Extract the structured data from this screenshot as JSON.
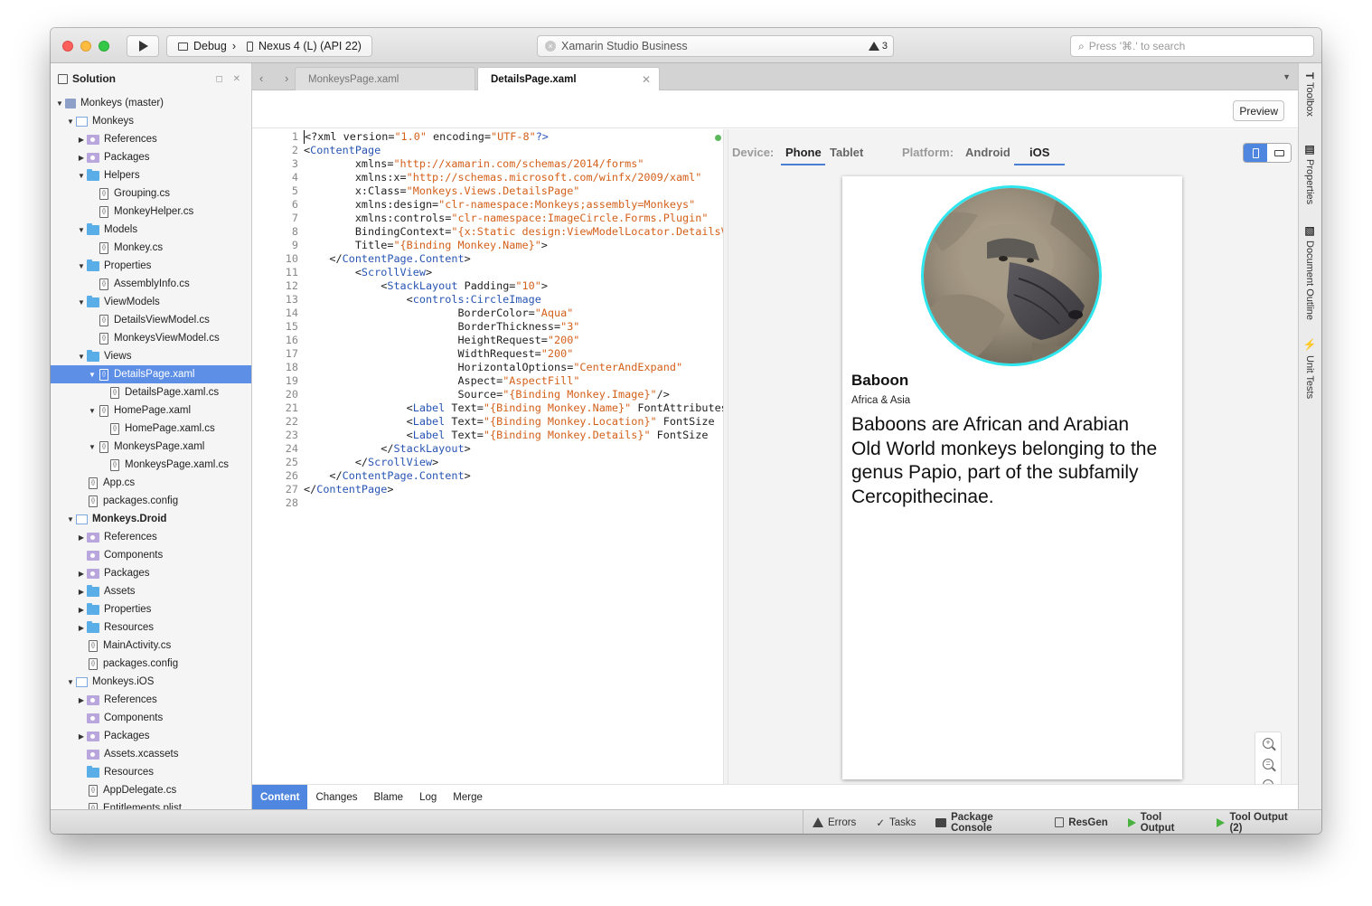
{
  "titlebar": {
    "config": "Debug",
    "config_sep": "›",
    "device": "Nexus 4 (L) (API 22)",
    "status": "Xamarin Studio Business",
    "warnings": "3",
    "search_placeholder": "Press '⌘.' to search"
  },
  "solution": {
    "title": "Solution",
    "controls": "◻ ✕",
    "rows": [
      {
        "label": "Monkeys (master)",
        "type": "solution",
        "arrow": "▼",
        "indent": 0
      },
      {
        "label": "Monkeys",
        "type": "project",
        "arrow": "▼",
        "indent": 1
      },
      {
        "label": "References",
        "type": "pfolder",
        "arrow": "▶",
        "indent": 2
      },
      {
        "label": "Packages",
        "type": "pfolder",
        "arrow": "▶",
        "indent": 2
      },
      {
        "label": "Helpers",
        "type": "folder",
        "arrow": "▼",
        "indent": 2
      },
      {
        "label": "Grouping.cs",
        "type": "file",
        "arrow": "",
        "indent": 3
      },
      {
        "label": "MonkeyHelper.cs",
        "type": "file",
        "arrow": "",
        "indent": 3
      },
      {
        "label": "Models",
        "type": "folder",
        "arrow": "▼",
        "indent": 2
      },
      {
        "label": "Monkey.cs",
        "type": "file",
        "arrow": "",
        "indent": 3
      },
      {
        "label": "Properties",
        "type": "folder",
        "arrow": "▼",
        "indent": 2
      },
      {
        "label": "AssemblyInfo.cs",
        "type": "file",
        "arrow": "",
        "indent": 3
      },
      {
        "label": "ViewModels",
        "type": "folder",
        "arrow": "▼",
        "indent": 2
      },
      {
        "label": "DetailsViewModel.cs",
        "type": "file",
        "arrow": "",
        "indent": 3
      },
      {
        "label": "MonkeysViewModel.cs",
        "type": "file",
        "arrow": "",
        "indent": 3
      },
      {
        "label": "Views",
        "type": "folder",
        "arrow": "▼",
        "indent": 2
      },
      {
        "label": "DetailsPage.xaml",
        "type": "file",
        "arrow": "▼",
        "indent": 3,
        "selected": true
      },
      {
        "label": "DetailsPage.xaml.cs",
        "type": "file",
        "arrow": "",
        "indent": 4
      },
      {
        "label": "HomePage.xaml",
        "type": "file",
        "arrow": "▼",
        "indent": 3
      },
      {
        "label": "HomePage.xaml.cs",
        "type": "file",
        "arrow": "",
        "indent": 4
      },
      {
        "label": "MonkeysPage.xaml",
        "type": "file",
        "arrow": "▼",
        "indent": 3
      },
      {
        "label": "MonkeysPage.xaml.cs",
        "type": "file",
        "arrow": "",
        "indent": 4
      },
      {
        "label": "App.cs",
        "type": "file",
        "arrow": "",
        "indent": 2
      },
      {
        "label": "packages.config",
        "type": "file",
        "arrow": "",
        "indent": 2
      },
      {
        "label": "Monkeys.Droid",
        "type": "project",
        "arrow": "▼",
        "indent": 1,
        "bold": true
      },
      {
        "label": "References",
        "type": "pfolder",
        "arrow": "▶",
        "indent": 2
      },
      {
        "label": "Components",
        "type": "pfolder",
        "arrow": "",
        "indent": 2
      },
      {
        "label": "Packages",
        "type": "pfolder",
        "arrow": "▶",
        "indent": 2
      },
      {
        "label": "Assets",
        "type": "folder",
        "arrow": "▶",
        "indent": 2
      },
      {
        "label": "Properties",
        "type": "folder",
        "arrow": "▶",
        "indent": 2
      },
      {
        "label": "Resources",
        "type": "folder",
        "arrow": "▶",
        "indent": 2
      },
      {
        "label": "MainActivity.cs",
        "type": "file",
        "arrow": "",
        "indent": 2
      },
      {
        "label": "packages.config",
        "type": "file",
        "arrow": "",
        "indent": 2
      },
      {
        "label": "Monkeys.iOS",
        "type": "project",
        "arrow": "▼",
        "indent": 1
      },
      {
        "label": "References",
        "type": "pfolder",
        "arrow": "▶",
        "indent": 2
      },
      {
        "label": "Components",
        "type": "pfolder",
        "arrow": "",
        "indent": 2
      },
      {
        "label": "Packages",
        "type": "pfolder",
        "arrow": "▶",
        "indent": 2
      },
      {
        "label": "Assets.xcassets",
        "type": "pfolder",
        "arrow": "",
        "indent": 2
      },
      {
        "label": "Resources",
        "type": "folder",
        "arrow": "",
        "indent": 2
      },
      {
        "label": "AppDelegate.cs",
        "type": "file",
        "arrow": "",
        "indent": 2
      },
      {
        "label": "Entitlements.plist",
        "type": "file",
        "arrow": "",
        "indent": 2
      }
    ]
  },
  "tabs": {
    "nav": "‹ ›",
    "tab1": "MonkeysPage.xaml",
    "tab2": "DetailsPage.xaml",
    "close": "✕",
    "dropdown": "▼"
  },
  "editor": {
    "preview_button": "Preview",
    "code": [
      [
        [
          "p",
          "<?xml version="
        ],
        [
          "s",
          "\"1.0\""
        ],
        [
          "p",
          " encoding="
        ],
        [
          "s",
          "\"UTF-8\""
        ],
        [
          "t",
          "?>"
        ]
      ],
      [
        [
          "p",
          "<"
        ],
        [
          "t",
          "ContentPage"
        ]
      ],
      [
        [
          "p",
          "        xmlns="
        ],
        [
          "s",
          "\"http://xamarin.com/schemas/2014/forms\""
        ]
      ],
      [
        [
          "p",
          "        xmlns:x="
        ],
        [
          "s",
          "\"http://schemas.microsoft.com/winfx/2009/xaml\""
        ]
      ],
      [
        [
          "p",
          "        x:Class="
        ],
        [
          "s",
          "\"Monkeys.Views.DetailsPage\""
        ]
      ],
      [
        [
          "p",
          "        xmlns:design="
        ],
        [
          "s",
          "\"clr-namespace:Monkeys;assembly=Monkeys\""
        ]
      ],
      [
        [
          "p",
          "        xmlns:controls="
        ],
        [
          "s",
          "\"clr-namespace:ImageCircle.Forms.Plugin\""
        ]
      ],
      [
        [
          "p",
          "        BindingContext="
        ],
        [
          "s",
          "\"{x:Static design:ViewModelLocator.DetailsViewModel}\""
        ]
      ],
      [
        [
          "p",
          "        Title="
        ],
        [
          "s",
          "\"{Binding Monkey.Name}\""
        ],
        [
          "p",
          ">"
        ]
      ],
      [
        [
          "p",
          "    </"
        ],
        [
          "t",
          "ContentPage.Content"
        ],
        [
          "p",
          ">"
        ]
      ],
      [
        [
          "p",
          "        <"
        ],
        [
          "t",
          "ScrollView"
        ],
        [
          "p",
          ">"
        ]
      ],
      [
        [
          "p",
          "            <"
        ],
        [
          "t",
          "StackLayout"
        ],
        [
          "p",
          " Padding="
        ],
        [
          "s",
          "\"10\""
        ],
        [
          "p",
          ">"
        ]
      ],
      [
        [
          "p",
          "                <"
        ],
        [
          "t",
          "controls:CircleImage"
        ]
      ],
      [
        [
          "p",
          "                        BorderColor="
        ],
        [
          "s",
          "\"Aqua\""
        ]
      ],
      [
        [
          "p",
          "                        BorderThickness="
        ],
        [
          "s",
          "\"3\""
        ]
      ],
      [
        [
          "p",
          "                        HeightRequest="
        ],
        [
          "s",
          "\"200\""
        ]
      ],
      [
        [
          "p",
          "                        WidthRequest="
        ],
        [
          "s",
          "\"200\""
        ]
      ],
      [
        [
          "p",
          "                        HorizontalOptions="
        ],
        [
          "s",
          "\"CenterAndExpand\""
        ]
      ],
      [
        [
          "p",
          "                        Aspect="
        ],
        [
          "s",
          "\"AspectFill\""
        ]
      ],
      [
        [
          "p",
          "                        Source="
        ],
        [
          "s",
          "\"{Binding Monkey.Image}\""
        ],
        [
          "p",
          "/>"
        ]
      ],
      [
        [
          "p",
          "                <"
        ],
        [
          "t",
          "Label"
        ],
        [
          "p",
          " Text="
        ],
        [
          "s",
          "\"{Binding Monkey.Name}\""
        ],
        [
          "p",
          " FontAttributes"
        ]
      ],
      [
        [
          "p",
          "                <"
        ],
        [
          "t",
          "Label"
        ],
        [
          "p",
          " Text="
        ],
        [
          "s",
          "\"{Binding Monkey.Location}\""
        ],
        [
          "p",
          " FontSize"
        ]
      ],
      [
        [
          "p",
          "                <"
        ],
        [
          "t",
          "Label"
        ],
        [
          "p",
          " Text="
        ],
        [
          "s",
          "\"{Binding Monkey.Details}\""
        ],
        [
          "p",
          " FontSize"
        ]
      ],
      [
        [
          "p",
          "            </"
        ],
        [
          "t",
          "StackLayout"
        ],
        [
          "p",
          ">"
        ]
      ],
      [
        [
          "p",
          "        </"
        ],
        [
          "t",
          "ScrollView"
        ],
        [
          "p",
          ">"
        ]
      ],
      [
        [
          "p",
          "    </"
        ],
        [
          "t",
          "ContentPage.Content"
        ],
        [
          "p",
          ">"
        ]
      ],
      [
        [
          "p",
          "</"
        ],
        [
          "t",
          "ContentPage"
        ],
        [
          "p",
          ">"
        ]
      ],
      [
        [
          "p",
          ""
        ]
      ]
    ]
  },
  "preview": {
    "device_label": "Device:",
    "device_phone": "Phone",
    "device_tablet": "Tablet",
    "platform_label": "Platform:",
    "platform_android": "Android",
    "platform_ios": "iOS",
    "monkey_name": "Baboon",
    "monkey_location": "Africa & Asia",
    "monkey_details": "Baboons are African and Arabian Old World monkeys belonging to the genus Papio, part of the subfamily Cercopithecinae.",
    "zoom_in": "+",
    "zoom_fit": "=",
    "zoom_out": "−"
  },
  "subtabs": [
    "Content",
    "Changes",
    "Blame",
    "Log",
    "Merge"
  ],
  "statusbar": {
    "errors": "Errors",
    "tasks_check": "✓",
    "tasks": "Tasks",
    "package_console": "Package Console",
    "resgen": "ResGen",
    "tool_output": "Tool Output",
    "tool_output_2": "Tool Output (2)"
  },
  "rightpads": {
    "toolbox": "Toolbox",
    "properties": "Properties",
    "document_outline": "Document Outline",
    "unit_tests": "Unit Tests",
    "toolbox_icon": "T",
    "properties_icon": "▤",
    "outline_icon": "▧",
    "unit_tests_icon": "⚡"
  },
  "colors": {
    "accent": "#4f86e0",
    "selection": "#5d8fe6",
    "xml_tag": "#2855b3",
    "xml_string": "#d4601a",
    "circle_border": "#2ee6ee"
  }
}
